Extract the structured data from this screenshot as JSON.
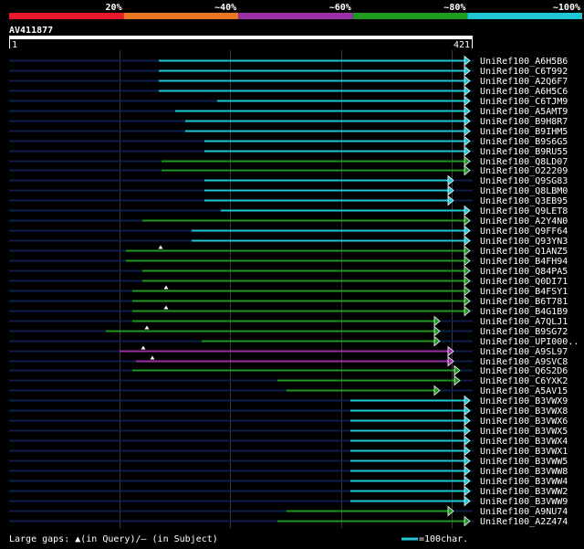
{
  "query_id": "AV411877",
  "query_start": "1",
  "query_end": "421",
  "legend_bar": [
    {
      "label": "20%",
      "color": "#e8192c"
    },
    {
      "label": "~40%",
      "color": "#e87722"
    },
    {
      "label": "~60%",
      "color": "#9b2fa8"
    },
    {
      "label": "~80%",
      "color": "#1e9a1e"
    },
    {
      "label": "~100%",
      "color": "#1ec6d6"
    }
  ],
  "footer": {
    "gaps_note": "Large gaps: ▲(in Query)/– (in Subject)",
    "scale_note": "=100char."
  },
  "chart_data": {
    "type": "alignment-map",
    "query_length": 421,
    "identity_colors": {
      "cyan": "#1ec6d6",
      "green": "#1e9a1e",
      "purple": "#9b2fa8"
    },
    "gridlines_at_percent": [
      20,
      40,
      60,
      80
    ],
    "hits": [
      {
        "name": "UniRef100_A6H5B6",
        "start": 174,
        "end": 515,
        "color": "cyan"
      },
      {
        "name": "UniRef100_C6T992",
        "start": 174,
        "end": 515,
        "color": "cyan"
      },
      {
        "name": "UniRef100_A2Q6F7",
        "start": 174,
        "end": 515,
        "color": "cyan"
      },
      {
        "name": "UniRef100_A6H5C6",
        "start": 174,
        "end": 515,
        "color": "cyan"
      },
      {
        "name": "UniRef100_C6TJM9",
        "start": 238,
        "end": 515,
        "color": "cyan"
      },
      {
        "name": "UniRef100_A5AMT9",
        "start": 192,
        "end": 515,
        "color": "cyan"
      },
      {
        "name": "UniRef100_B9H8R7",
        "start": 203,
        "end": 515,
        "color": "cyan"
      },
      {
        "name": "UniRef100_B9IHM5",
        "start": 203,
        "end": 515,
        "color": "cyan"
      },
      {
        "name": "UniRef100_B9S6G5",
        "start": 224,
        "end": 515,
        "color": "cyan"
      },
      {
        "name": "UniRef100_B9RU55",
        "start": 224,
        "end": 515,
        "color": "cyan"
      },
      {
        "name": "UniRef100_Q8LD07",
        "start": 177,
        "end": 515,
        "color": "green"
      },
      {
        "name": "UniRef100_O22209",
        "start": 177,
        "end": 515,
        "color": "green"
      },
      {
        "name": "UniRef100_Q9SG83",
        "start": 224,
        "end": 497,
        "color": "cyan"
      },
      {
        "name": "UniRef100_Q8LBM0",
        "start": 224,
        "end": 497,
        "color": "cyan"
      },
      {
        "name": "UniRef100_Q3EB95",
        "start": 224,
        "end": 497,
        "color": "cyan"
      },
      {
        "name": "UniRef100_Q9LET8",
        "start": 242,
        "end": 515,
        "color": "cyan"
      },
      {
        "name": "UniRef100_A2Y4N0",
        "start": 156,
        "end": 515,
        "color": "green"
      },
      {
        "name": "UniRef100_Q9FF64",
        "start": 210,
        "end": 515,
        "color": "cyan"
      },
      {
        "name": "UniRef100_Q93YN3",
        "start": 210,
        "end": 515,
        "color": "cyan"
      },
      {
        "name": "UniRef100_Q1ANZ5",
        "start": 138,
        "end": 515,
        "color": "green"
      },
      {
        "name": "UniRef100_B4FH94",
        "start": 138,
        "end": 515,
        "color": "green"
      },
      {
        "name": "UniRef100_Q84PA5",
        "start": 156,
        "end": 515,
        "color": "green"
      },
      {
        "name": "UniRef100_Q0DI71",
        "start": 156,
        "end": 515,
        "color": "green"
      },
      {
        "name": "UniRef100_B4FSY1",
        "start": 145,
        "end": 515,
        "color": "green"
      },
      {
        "name": "UniRef100_B6T781",
        "start": 145,
        "end": 515,
        "color": "green"
      },
      {
        "name": "UniRef100_B4G1B9",
        "start": 145,
        "end": 515,
        "color": "green"
      },
      {
        "name": "UniRef100_A7QLJ1",
        "start": 145,
        "end": 482,
        "color": "green"
      },
      {
        "name": "UniRef100_B9SG72",
        "start": 116,
        "end": 482,
        "color": "green"
      },
      {
        "name": "UniRef100_UPI000..",
        "start": 221,
        "end": 482,
        "color": "green"
      },
      {
        "name": "UniRef100_A9SL97",
        "start": 131,
        "end": 497,
        "color": "purple"
      },
      {
        "name": "UniRef100_A9SVC8",
        "start": 149,
        "end": 497,
        "color": "purple"
      },
      {
        "name": "UniRef100_Q6S2D6",
        "start": 145,
        "end": 504,
        "color": "green"
      },
      {
        "name": "UniRef100_C6YXK2",
        "start": 304,
        "end": 504,
        "color": "green"
      },
      {
        "name": "UniRef100_A5AV15",
        "start": 314,
        "end": 482,
        "color": "green"
      },
      {
        "name": "UniRef100_B3VWX9",
        "start": 384,
        "end": 515,
        "color": "cyan"
      },
      {
        "name": "UniRef100_B3VWX8",
        "start": 384,
        "end": 515,
        "color": "cyan"
      },
      {
        "name": "UniRef100_B3VWX6",
        "start": 384,
        "end": 515,
        "color": "cyan"
      },
      {
        "name": "UniRef100_B3VWX5",
        "start": 384,
        "end": 515,
        "color": "cyan"
      },
      {
        "name": "UniRef100_B3VWX4",
        "start": 384,
        "end": 515,
        "color": "cyan"
      },
      {
        "name": "UniRef100_B3VWX1",
        "start": 384,
        "end": 515,
        "color": "cyan"
      },
      {
        "name": "UniRef100_B3VWW5",
        "start": 384,
        "end": 515,
        "color": "cyan"
      },
      {
        "name": "UniRef100_B3VWW8",
        "start": 384,
        "end": 515,
        "color": "cyan"
      },
      {
        "name": "UniRef100_B3VWW4",
        "start": 384,
        "end": 515,
        "color": "cyan"
      },
      {
        "name": "UniRef100_B3VWW2",
        "start": 384,
        "end": 515,
        "color": "cyan"
      },
      {
        "name": "UniRef100_B3VWW9",
        "start": 384,
        "end": 515,
        "color": "cyan"
      },
      {
        "name": "UniRef100_A9NU74",
        "start": 314,
        "end": 497,
        "color": "green"
      },
      {
        "name": "UniRef100_A2Z474",
        "start": 304,
        "end": 515,
        "color": "green"
      }
    ],
    "gap_markers": [
      {
        "row": 19,
        "pos": 176
      },
      {
        "row": 23,
        "pos": 182
      },
      {
        "row": 25,
        "pos": 182
      },
      {
        "row": 27,
        "pos": 161
      },
      {
        "row": 29,
        "pos": 157
      },
      {
        "row": 30,
        "pos": 167
      }
    ]
  }
}
